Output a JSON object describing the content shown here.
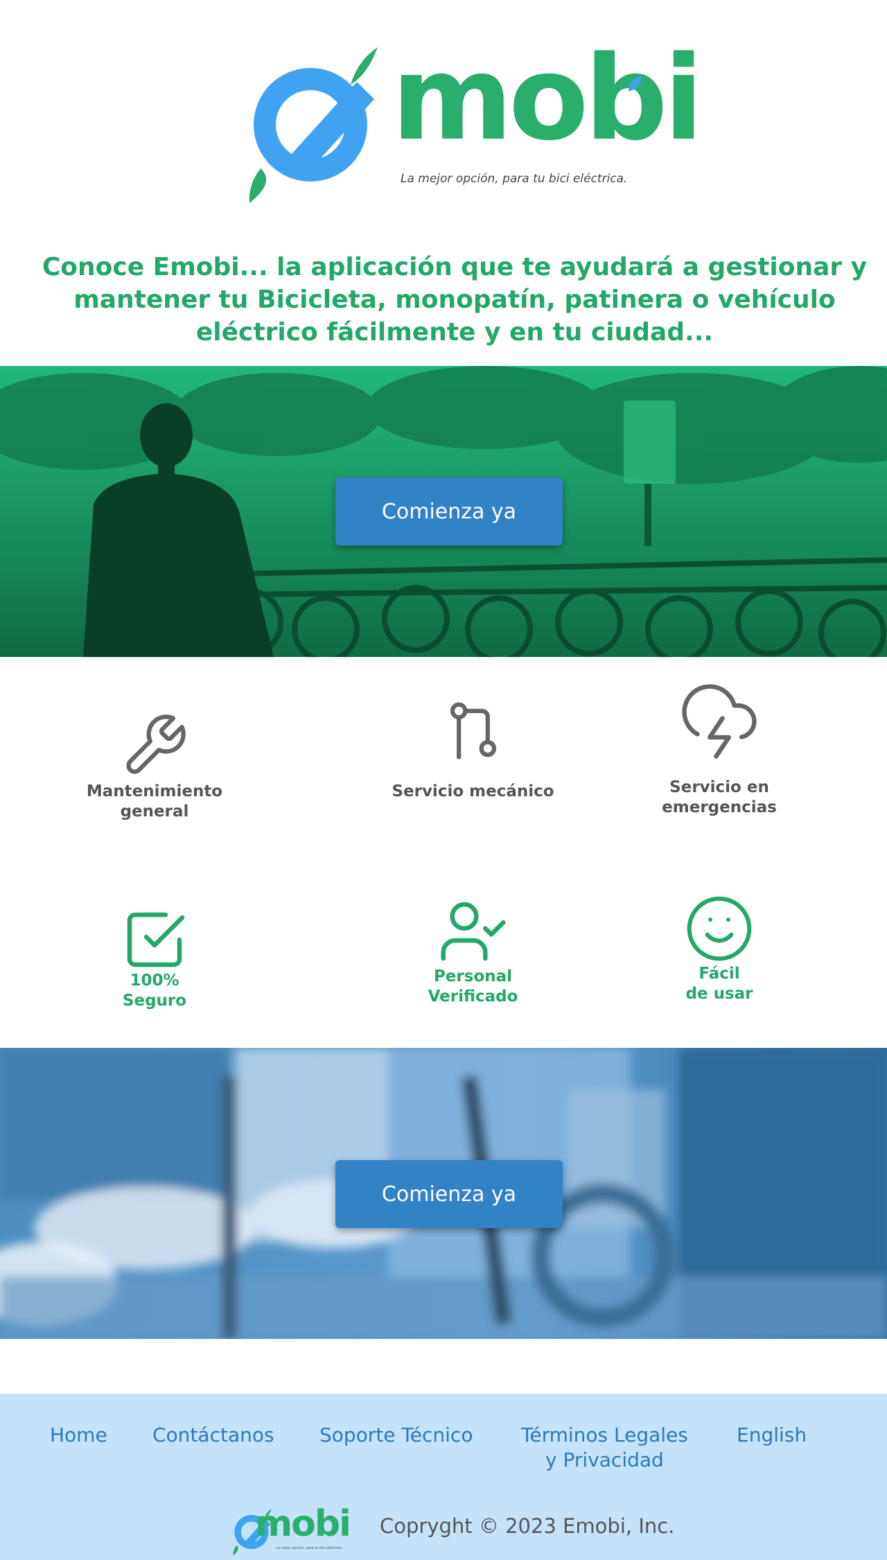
{
  "brand": {
    "name": "mobi",
    "tagline": "La mejor opción, para tu bici eléctrica.",
    "colors": {
      "green": "#2aae6c",
      "blue": "#40a3f2",
      "button": "#3282c6",
      "footer_bg": "#c4e3fa"
    }
  },
  "intro": "Conoce Emobi... la aplicación que te ayudará a gestionar y mantener tu Bicicleta, monopatín, patinera o vehículo eléctrico fácilmente y en tu ciudad...",
  "hero_top": {
    "cta": "Comienza ya"
  },
  "services": [
    {
      "label": "Mantenimiento\ngeneral",
      "icon": "wrench-icon"
    },
    {
      "label": "Servicio mecánico",
      "icon": "git-pull-icon"
    },
    {
      "label": "Servicio en\nemergencias",
      "icon": "cloud-lightning-icon"
    }
  ],
  "benefits": [
    {
      "label": "100%\nSeguro",
      "icon": "checkbox-icon"
    },
    {
      "label": "Personal\nVerificado",
      "icon": "user-check-icon"
    },
    {
      "label": "Fácil\nde usar",
      "icon": "smile-icon"
    }
  ],
  "hero_bottom": {
    "cta": "Comienza ya"
  },
  "footer": {
    "links": [
      "Home",
      "Contáctanos",
      "Soporte Técnico",
      "Términos Legales\ny Privacidad",
      "English"
    ],
    "copyright": "Copryght © 2023 Emobi, Inc."
  }
}
